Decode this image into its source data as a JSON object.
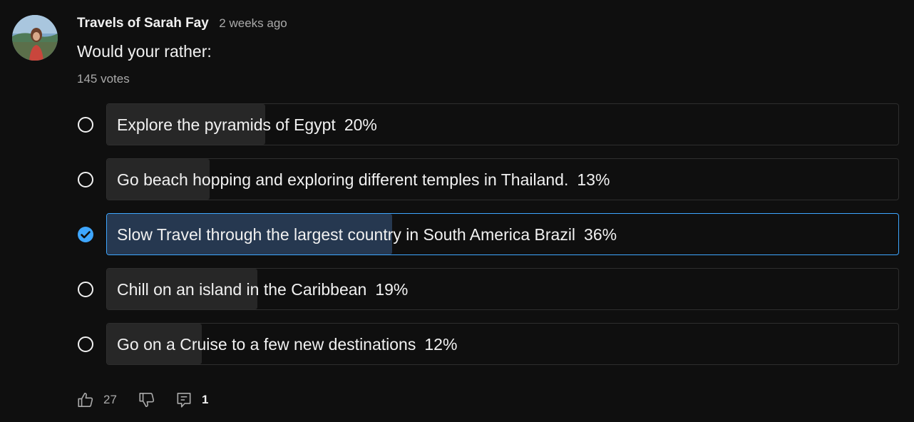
{
  "post": {
    "author": "Travels of Sarah Fay",
    "time": "2 weeks ago",
    "text": "Would your rather:",
    "votes": "145 votes"
  },
  "poll": {
    "options": [
      {
        "label": "Explore the pyramids of Egypt",
        "percent": "20%",
        "fill_fraction": 0.2,
        "selected": false
      },
      {
        "label": "Go beach hopping and exploring different temples in Thailand.",
        "percent": "13%",
        "fill_fraction": 0.13,
        "selected": false
      },
      {
        "label": "Slow Travel through the largest country in South America Brazil",
        "percent": "36%",
        "fill_fraction": 0.36,
        "selected": true
      },
      {
        "label": "Chill on an island in the Caribbean",
        "percent": "19%",
        "fill_fraction": 0.19,
        "selected": false
      },
      {
        "label": "Go on a Cruise to a few new destinations",
        "percent": "12%",
        "fill_fraction": 0.12,
        "selected": false
      }
    ]
  },
  "actions": {
    "likes": "27",
    "comments": "1"
  },
  "colors": {
    "background": "#0f0f0f",
    "accent": "#3ea6ff",
    "fill": "#272727",
    "selected_fill": "#263850"
  },
  "icons": [
    "thumbs-up-icon",
    "thumbs-down-icon",
    "comment-icon",
    "radio-icon",
    "check-circle-icon"
  ]
}
